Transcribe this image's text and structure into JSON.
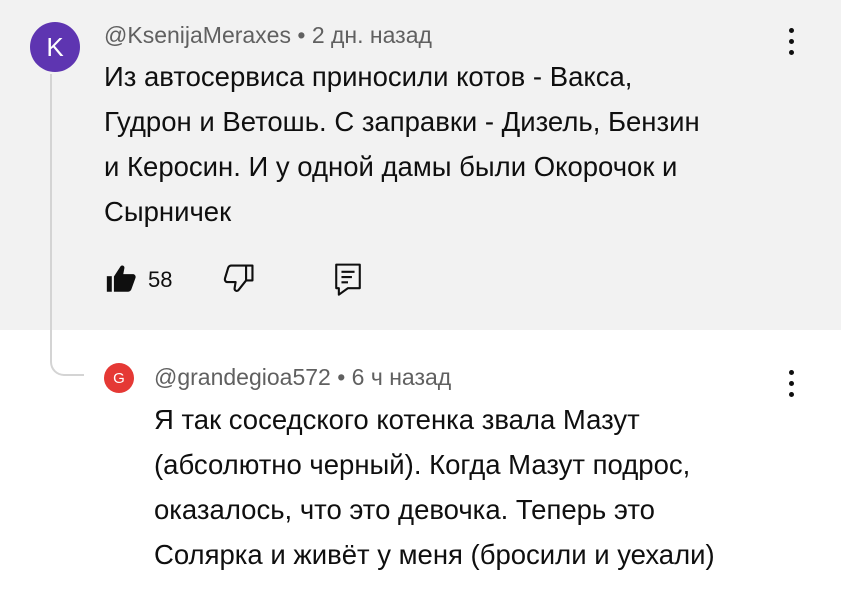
{
  "parent_comment": {
    "avatar_letter": "K",
    "author": "@KsenijaMeraxes",
    "separator": "•",
    "time": "2 дн. назад",
    "lines": [
      "Из автосервиса приносили котов - Вакса,",
      "Гудрон и Ветошь. С заправки - Дизель, Бензин",
      "и Керосин. И у одной дамы были Окорочок и",
      "Сырничек"
    ],
    "like_count": "58",
    "icons": {
      "like": "thumbs-up-filled-icon",
      "dislike": "thumbs-down-outline-icon",
      "reply": "reply-comment-icon",
      "menu": "more-vertical-icon"
    }
  },
  "reply_comment": {
    "avatar_letter": "G",
    "author": "@grandegioa572",
    "separator": "•",
    "time": "6 ч назад",
    "lines": [
      "Я так соседского котенка звала Мазут",
      "(абсолютно черный). Когда Мазут подрос,",
      "оказалось, что это девочка. Теперь это",
      "Солярка и живёт у меня (бросили и уехали)"
    ],
    "icons": {
      "menu": "more-vertical-icon"
    }
  },
  "colors": {
    "parent_background": "#f2f2f2",
    "avatar_k": "#5e35b1",
    "avatar_g": "#e53935",
    "meta_text": "#606060",
    "body_text": "#0f0f0f"
  }
}
